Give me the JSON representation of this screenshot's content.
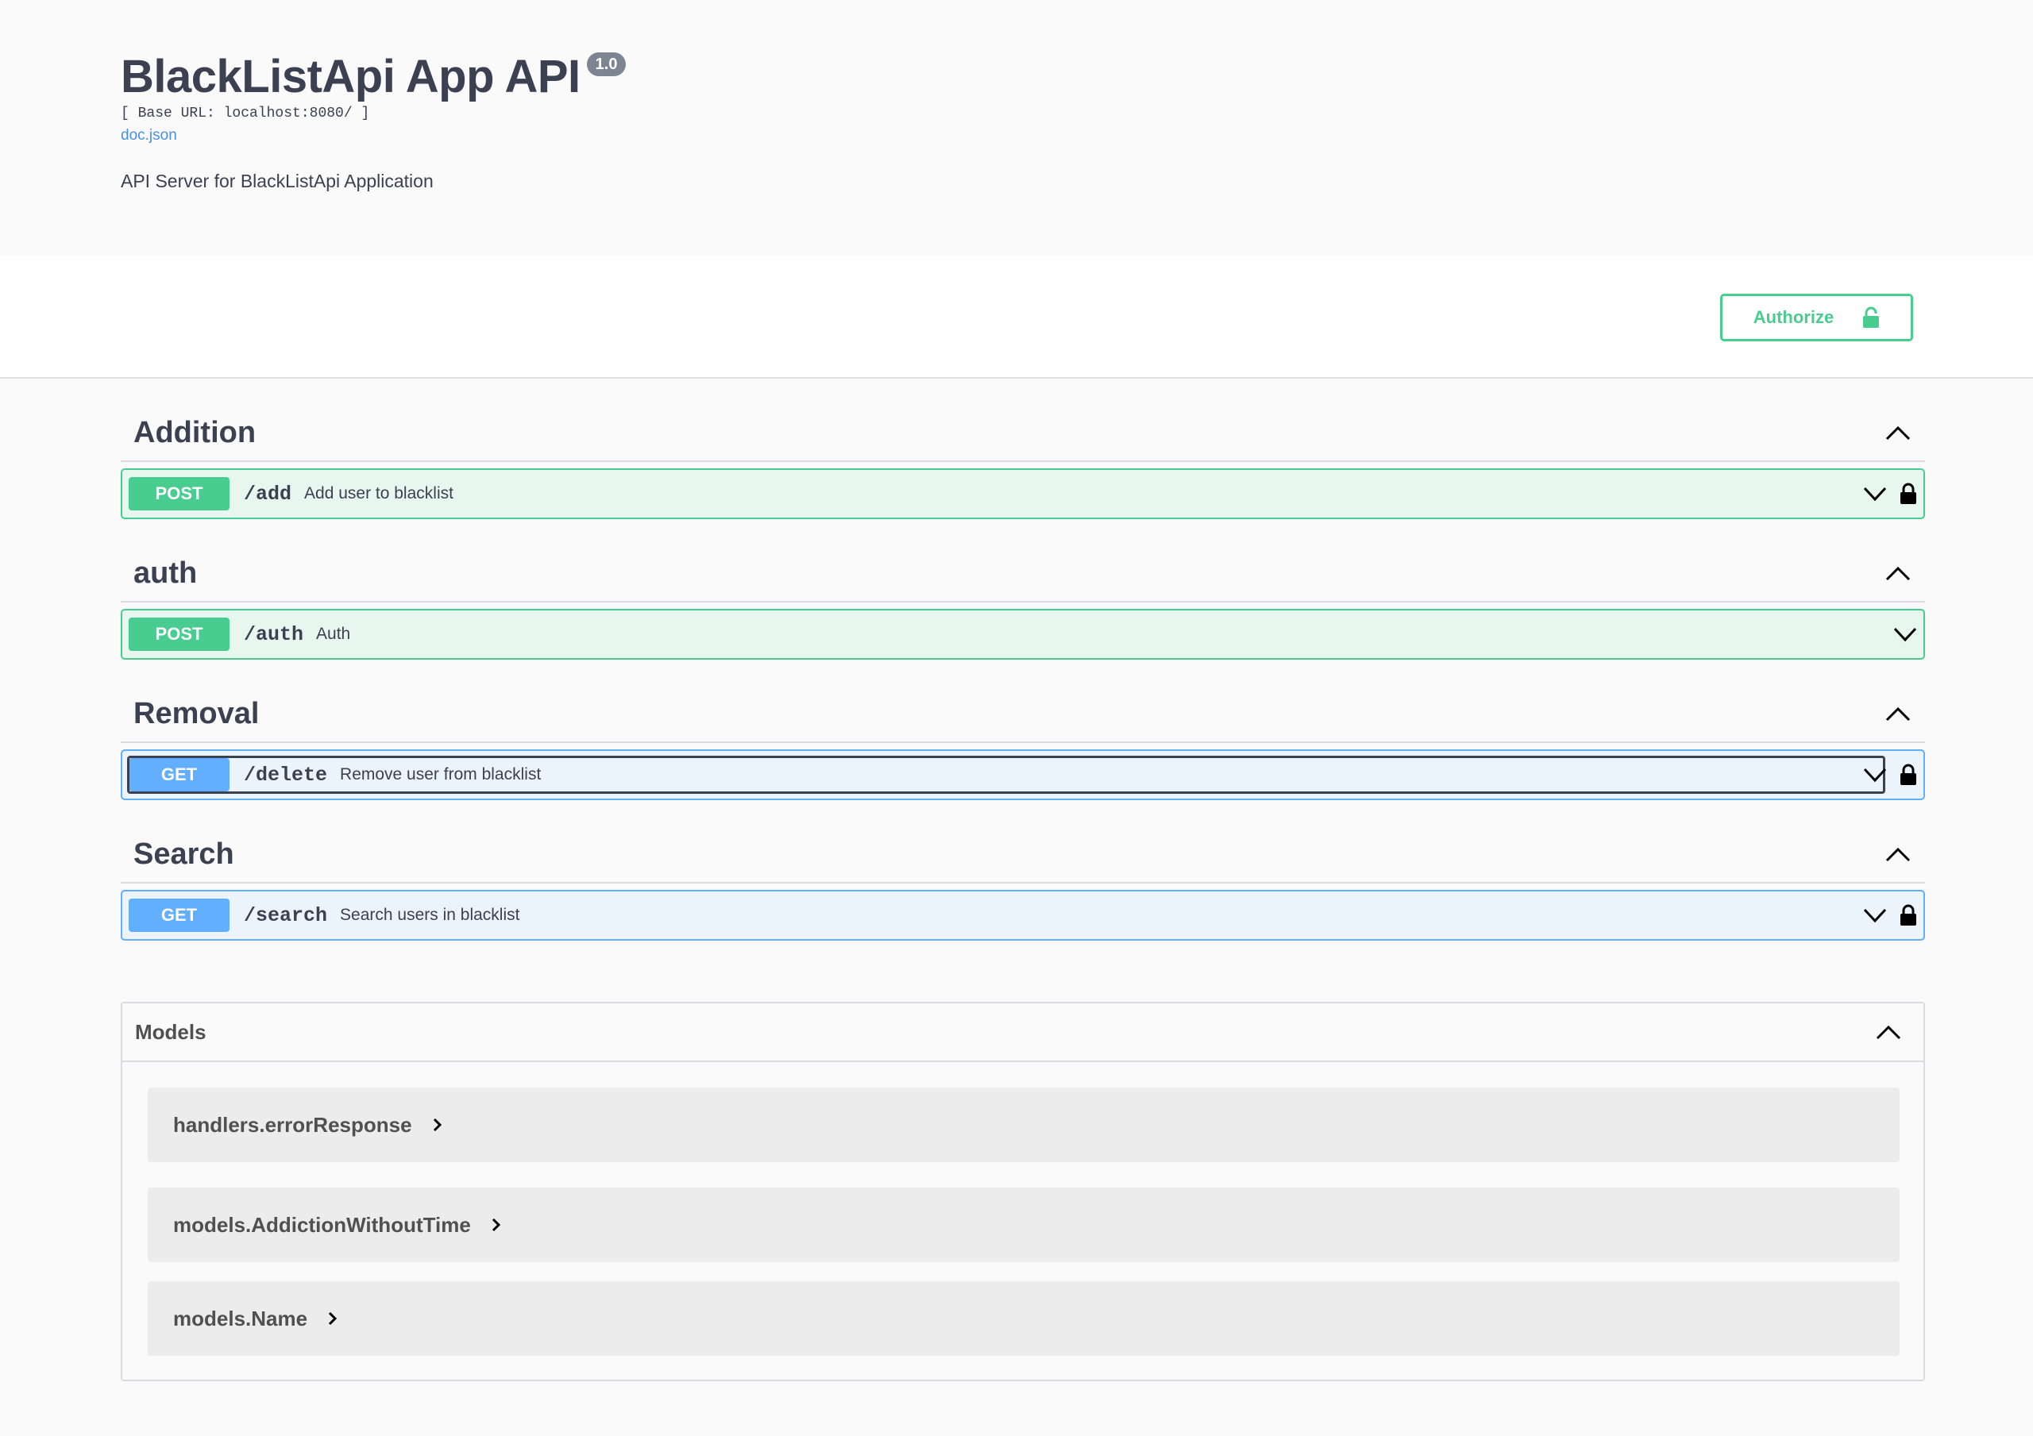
{
  "info": {
    "title": "BlackListApi App API",
    "version": "1.0",
    "base_url": "[ Base URL: localhost:8080/ ]",
    "doc_link": "doc.json",
    "description": "API Server for BlackListApi Application"
  },
  "scheme": {
    "authorize_label": "Authorize"
  },
  "tags": [
    {
      "name": "Addition",
      "operations": [
        {
          "method": "POST",
          "path": "/add",
          "summary": "Add user to blacklist",
          "locked": true
        }
      ]
    },
    {
      "name": "auth",
      "operations": [
        {
          "method": "POST",
          "path": "/auth",
          "summary": "Auth",
          "locked": false
        }
      ]
    },
    {
      "name": "Removal",
      "operations": [
        {
          "method": "GET",
          "path": "/delete",
          "summary": "Remove user from blacklist",
          "locked": true
        }
      ]
    },
    {
      "name": "Search",
      "operations": [
        {
          "method": "GET",
          "path": "/search",
          "summary": "Search users in blacklist",
          "locked": true
        }
      ]
    }
  ],
  "models": {
    "title": "Models",
    "items": [
      {
        "name": "handlers.errorResponse"
      },
      {
        "name": "models.AddictionWithoutTime"
      },
      {
        "name": "models.Name"
      }
    ]
  },
  "colors": {
    "post": "#49cc90",
    "get": "#61affe",
    "text": "#3b4151"
  }
}
